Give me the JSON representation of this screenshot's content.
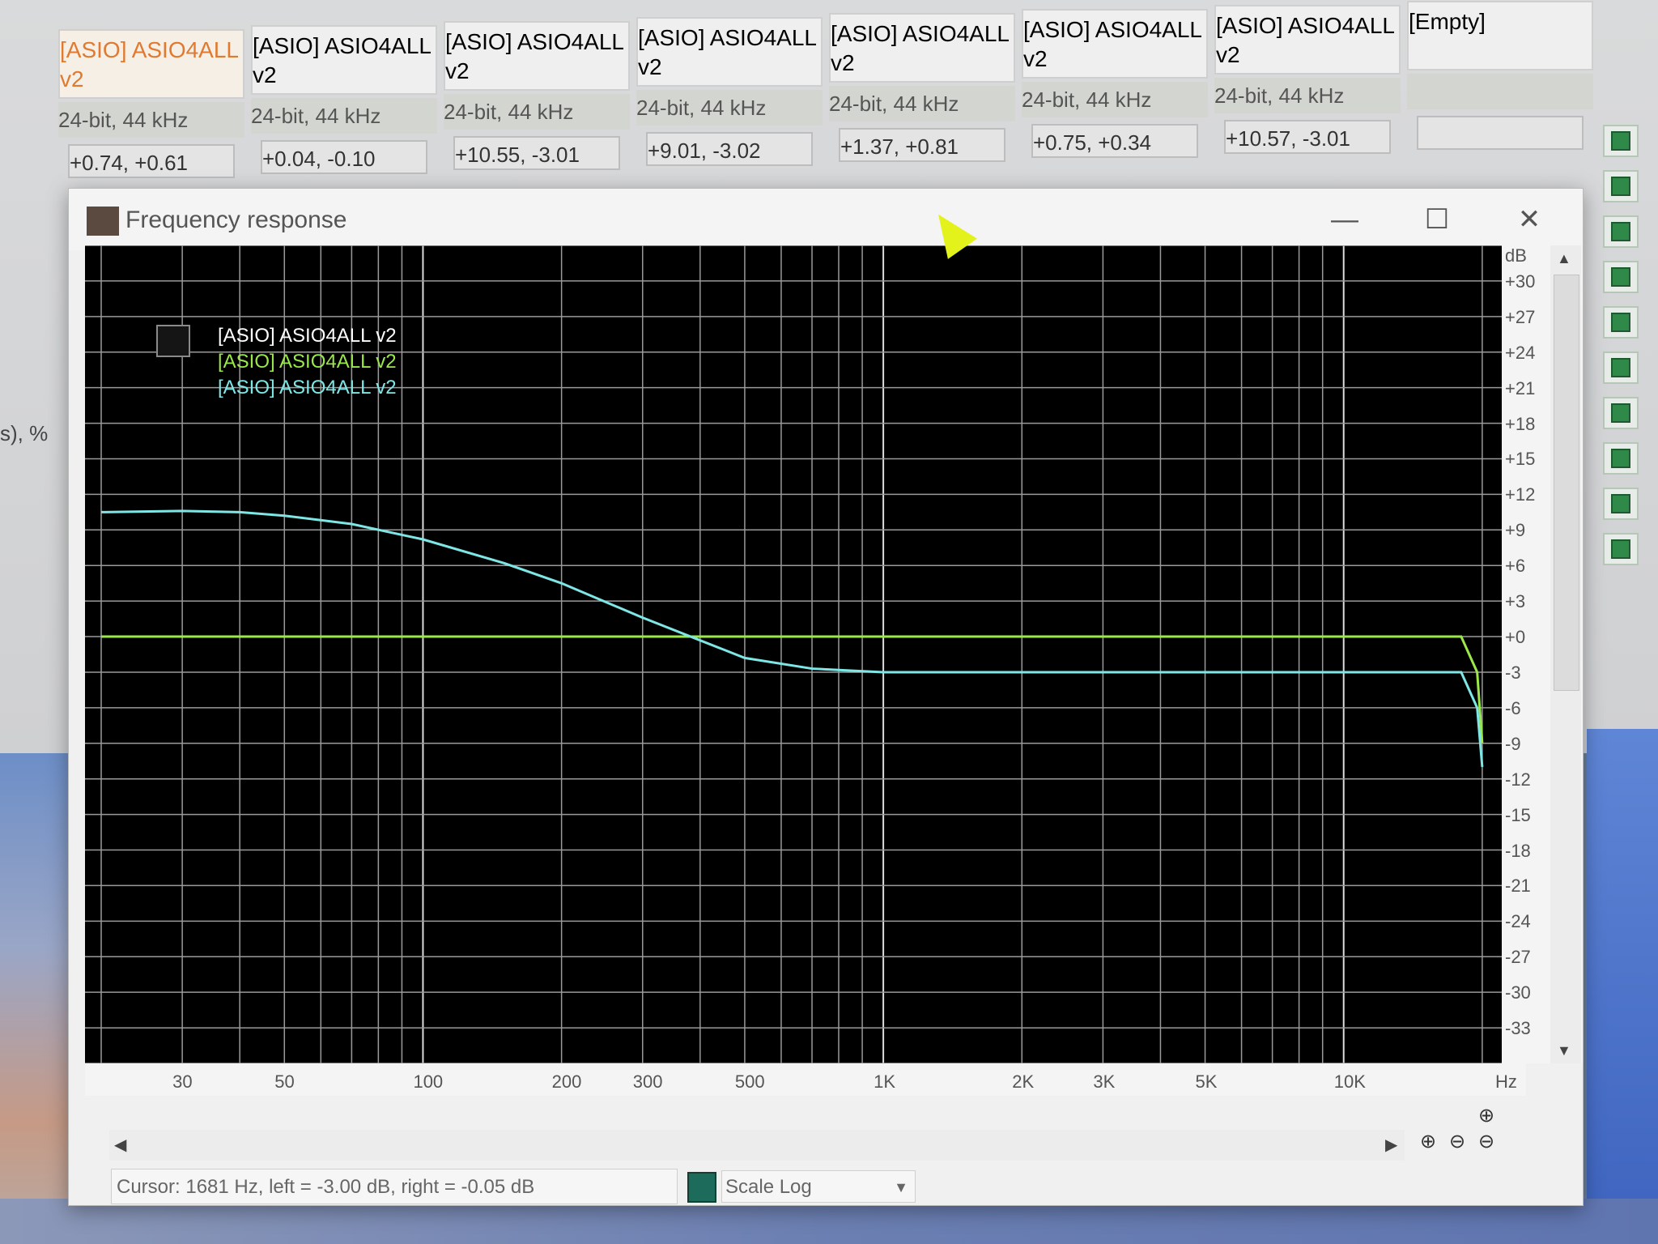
{
  "side_text": "s), %",
  "devices": [
    {
      "name": "[ASIO] ASIO4ALL v2",
      "format": "24-bit, 44 kHz",
      "levels": "+0.74, +0.61",
      "selected": true
    },
    {
      "name": "[ASIO] ASIO4ALL v2",
      "format": "24-bit, 44 kHz",
      "levels": "+0.04, -0.10",
      "selected": false
    },
    {
      "name": "[ASIO] ASIO4ALL v2",
      "format": "24-bit, 44 kHz",
      "levels": "+10.55, -3.01",
      "selected": false
    },
    {
      "name": "[ASIO] ASIO4ALL v2",
      "format": "24-bit, 44 kHz",
      "levels": "+9.01, -3.02",
      "selected": false
    },
    {
      "name": "[ASIO] ASIO4ALL v2",
      "format": "24-bit, 44 kHz",
      "levels": "+1.37, +0.81",
      "selected": false
    },
    {
      "name": "[ASIO] ASIO4ALL v2",
      "format": "24-bit, 44 kHz",
      "levels": "+0.75, +0.34",
      "selected": false
    },
    {
      "name": "[ASIO] ASIO4ALL v2",
      "format": "24-bit, 44 kHz",
      "levels": "+10.57, -3.01",
      "selected": false
    },
    {
      "name": "[Empty]",
      "format": "",
      "levels": "",
      "selected": false
    }
  ],
  "window": {
    "title": "Frequency response",
    "minimize": "—",
    "maximize": "☐",
    "close": "✕"
  },
  "legend": [
    {
      "label": "[ASIO] ASIO4ALL v2",
      "color": "#ffffff"
    },
    {
      "label": "[ASIO] ASIO4ALL v2",
      "color": "#9be84a"
    },
    {
      "label": "[ASIO] ASIO4ALL v2",
      "color": "#7fe6e6"
    }
  ],
  "yaxis": {
    "unit": "dB",
    "ticks": [
      "+30",
      "+27",
      "+24",
      "+21",
      "+18",
      "+15",
      "+12",
      "+9",
      "+6",
      "+3",
      "+0",
      "-3",
      "-6",
      "-9",
      "-12",
      "-15",
      "-18",
      "-21",
      "-24",
      "-27",
      "-30",
      "-33"
    ]
  },
  "xaxis": {
    "unit": "Hz",
    "ticks": [
      "30",
      "50",
      "100",
      "200",
      "300",
      "500",
      "1K",
      "2K",
      "3K",
      "5K",
      "10K"
    ]
  },
  "status": {
    "cursor_text": "Cursor: 1681 Hz, left = -3.00 dB, right = -0.05 dB",
    "scale_label": "Scale Log",
    "dropdown_arrow": "▼"
  },
  "chart_data": {
    "type": "line",
    "xlabel": "Hz",
    "ylabel": "dB",
    "xscale": "log",
    "xlim": [
      20,
      22050
    ],
    "ylim": [
      -36,
      33
    ],
    "grid": true,
    "legend": "top-left",
    "series": [
      {
        "name": "[ASIO] ASIO4ALL v2",
        "color": "#9be84a",
        "x": [
          20,
          30,
          50,
          100,
          200,
          300,
          500,
          1000,
          2000,
          5000,
          10000,
          18000,
          19500,
          20000
        ],
        "y": [
          0,
          0,
          0,
          0,
          0,
          0,
          0,
          0,
          0,
          0,
          0,
          0,
          -3,
          -9
        ]
      },
      {
        "name": "[ASIO] ASIO4ALL v2",
        "color": "#7fe6e6",
        "x": [
          20,
          30,
          40,
          50,
          70,
          100,
          150,
          200,
          300,
          500,
          700,
          1000,
          2000,
          5000,
          10000,
          18000,
          19500,
          20000
        ],
        "y": [
          10.5,
          10.6,
          10.5,
          10.2,
          9.5,
          8.2,
          6.2,
          4.5,
          1.6,
          -1.8,
          -2.7,
          -3.0,
          -3.0,
          -3.0,
          -3.0,
          -3.0,
          -6,
          -11
        ]
      }
    ]
  }
}
